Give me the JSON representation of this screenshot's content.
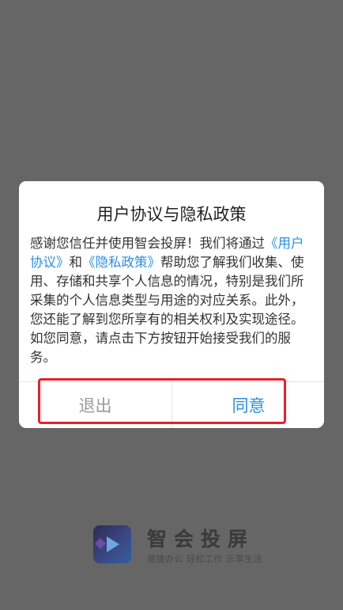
{
  "splash": {
    "app_name": "智会投屏",
    "slogan": "便捷办公 轻松工作 乐享生活"
  },
  "dialog": {
    "title": "用户协议与隐私政策",
    "body_part1": "感谢您信任并使用智会投屏！我们将通过",
    "link_user_agreement": "《用户协议》",
    "body_and": "和",
    "link_privacy_policy": "《隐私政策》",
    "body_part2": "帮助您了解我们收集、使用、存储和共享个人信息的情况，特别是我们所采集的个人信息类型与用途的对应关系。此外，您还能了解到您所享有的相关权利及实现途径。如您同意，请点击下方按钮开始接受我们的服务。",
    "exit_label": "退出",
    "agree_label": "同意"
  },
  "colors": {
    "overlay": "#666666",
    "link": "#2a8fe6",
    "highlight": "#e8202a"
  }
}
